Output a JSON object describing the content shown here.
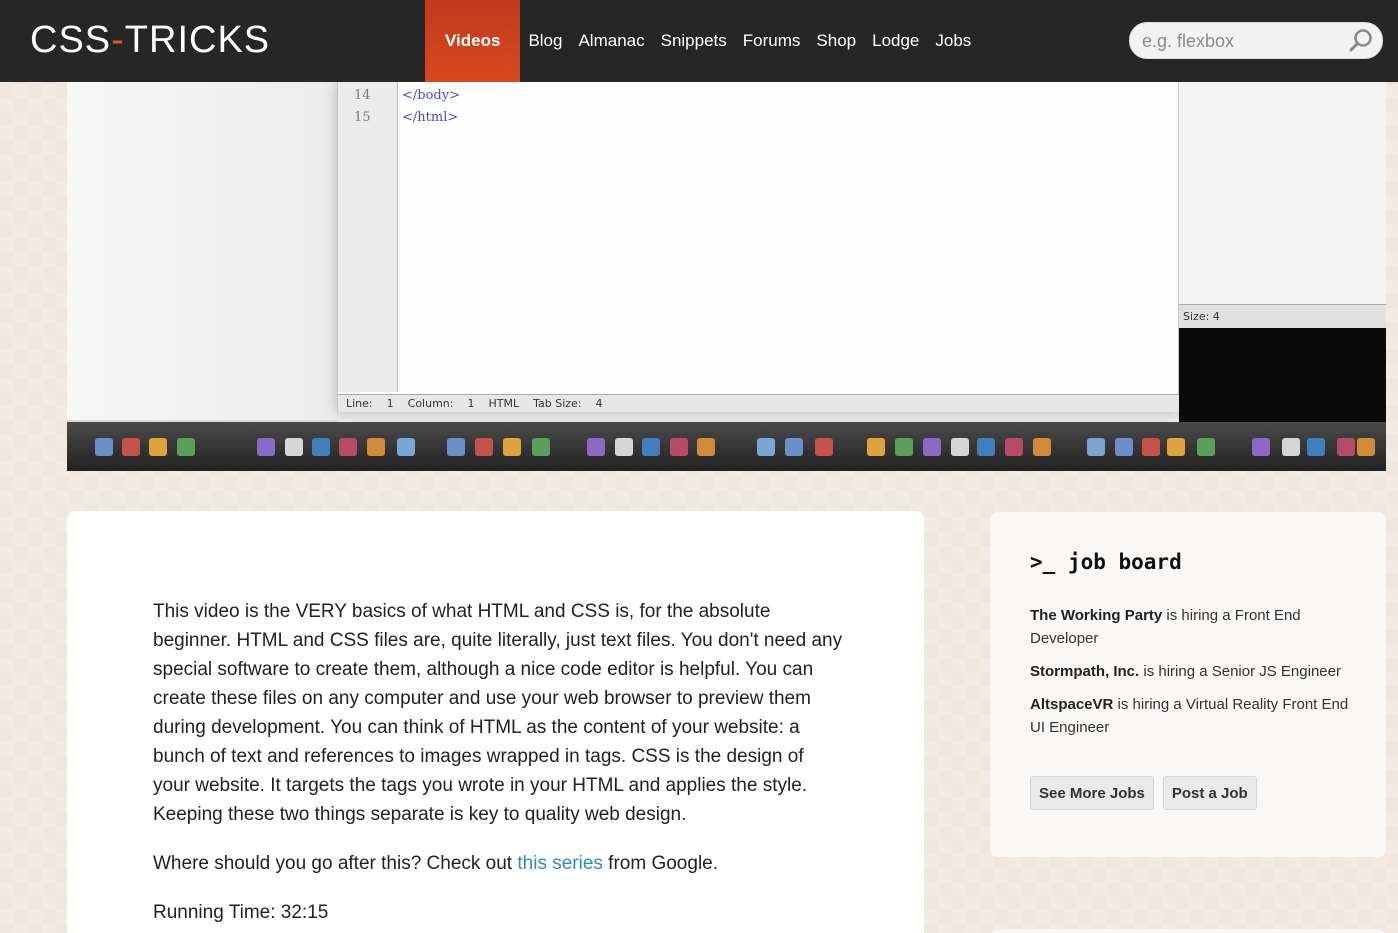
{
  "header": {
    "logo_left": "CSS",
    "logo_dash": "-",
    "logo_right": "TRICKS",
    "nav": [
      {
        "label": "Videos",
        "active": true
      },
      {
        "label": "Blog"
      },
      {
        "label": "Almanac"
      },
      {
        "label": "Snippets"
      },
      {
        "label": "Forums"
      },
      {
        "label": "Shop"
      },
      {
        "label": "Lodge"
      },
      {
        "label": "Jobs"
      }
    ],
    "search_placeholder": "e.g. flexbox"
  },
  "video": {
    "lines": [
      {
        "num": "14",
        "tag": "</body>"
      },
      {
        "num": "15",
        "tag": "</html>"
      }
    ],
    "status": {
      "line_label": "Line:",
      "line_value": "1",
      "column_label": "Column:",
      "column_value": "1",
      "syntax": "HTML",
      "tab_size_label": "Tab Size:",
      "tab_size_value": "4"
    },
    "right_bar": "Size: 4"
  },
  "content": {
    "paragraph1": "This video is the VERY basics of what HTML and CSS is, for the absolute beginner. HTML and CSS files are, quite literally, just text files. You don't need any special software to create them, although a nice code editor is helpful. You can create these files on any computer and use your web browser to preview them during development. You can think of HTML as the content of your website: a bunch of text and references to images wrapped in tags. CSS is the design of your website. It targets the tags you wrote in your HTML and applies the style. Keeping these two things separate is key to quality web design.",
    "p2_before": "Where should you go after this? Check out ",
    "p2_link": "this series",
    "p2_after": " from Google.",
    "running_time": "Running Time: 32:15"
  },
  "job_board": {
    "title": ">_ job board",
    "jobs": [
      {
        "company": "The Working Party",
        "text": " is hiring a Front End Developer"
      },
      {
        "company": "Stormpath, Inc.",
        "text": " is hiring a Senior JS Engineer"
      },
      {
        "company": "AltspaceVR",
        "text": " is hiring a Virtual Reality Front End UI Engineer"
      }
    ],
    "see_more": "See More Jobs",
    "post_job": "Post a Job"
  },
  "colors": {
    "header_bg": "#262626",
    "accent": "#d9481f",
    "link": "#2f8dc3"
  }
}
